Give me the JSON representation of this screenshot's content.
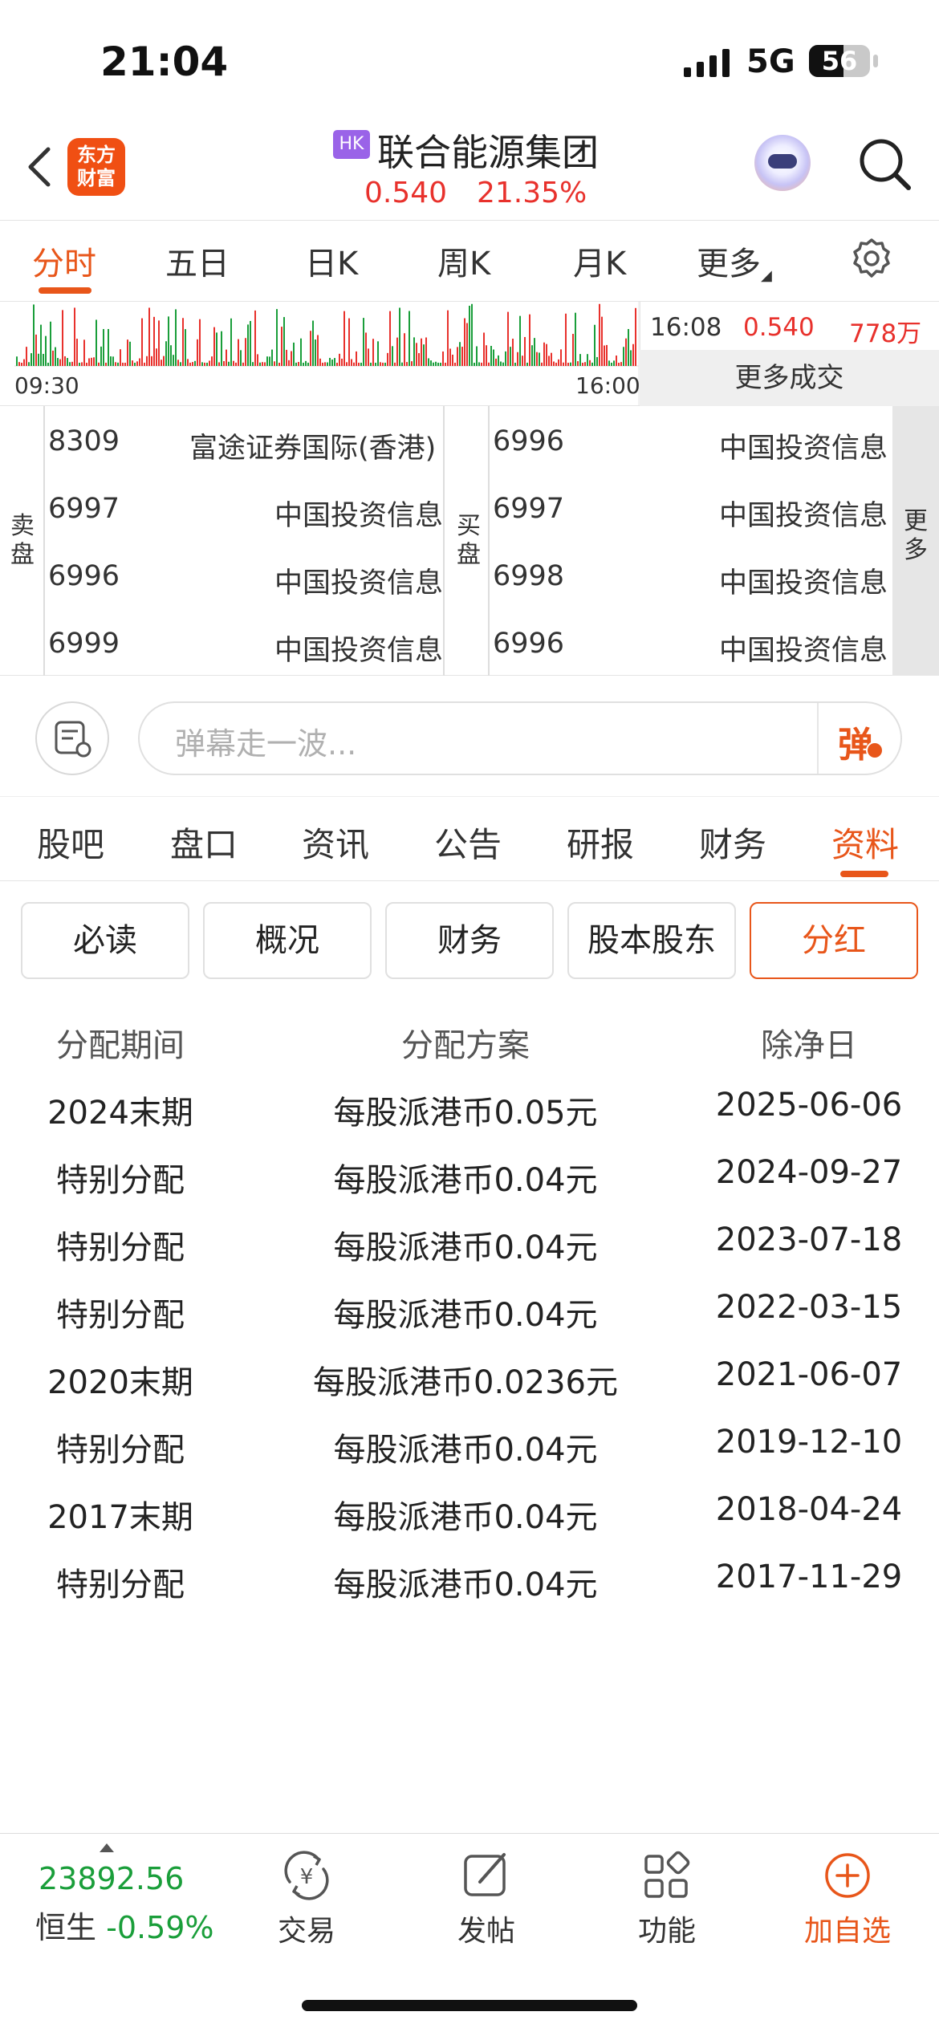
{
  "status_bar": {
    "time": "21:04",
    "network": "5G",
    "battery": "56",
    "battery_level": 0.56
  },
  "header": {
    "logo_text": [
      "东方",
      "财富"
    ],
    "market_badge": "HK",
    "stock_name": "联合能源集团",
    "price": "0.540",
    "change_pct": "21.35%",
    "icons": [
      "back-icon",
      "robot-avatar-icon",
      "search-icon"
    ],
    "colors": {
      "up": "#e8312c",
      "accent": "#e8561a",
      "badge": "#9a63e8"
    }
  },
  "chart_tabs": {
    "items": [
      "分时",
      "五日",
      "日K",
      "周K",
      "月K",
      "更多"
    ],
    "active": "分时",
    "settings_icon": "gear-icon"
  },
  "volume_strip": {
    "start_time": "09:30",
    "end_time": "16:00",
    "last_trade": {
      "time": "16:08",
      "price": "0.540",
      "volume": "778万"
    },
    "more_trades_label": "更多成交",
    "colors": {
      "up": "#e8312c",
      "down": "#1a9e3a"
    }
  },
  "broker_queue": {
    "sell_label": [
      "卖",
      "盘"
    ],
    "buy_label": [
      "买",
      "盘"
    ],
    "more_label": [
      "更",
      "多"
    ],
    "sell": [
      {
        "code": "8309",
        "name": "富途证券国际(香港)"
      },
      {
        "code": "6997",
        "name": "中国投资信息"
      },
      {
        "code": "6996",
        "name": "中国投资信息"
      },
      {
        "code": "6999",
        "name": "中国投资信息"
      }
    ],
    "buy": [
      {
        "code": "6996",
        "name": "中国投资信息"
      },
      {
        "code": "6997",
        "name": "中国投资信息"
      },
      {
        "code": "6998",
        "name": "中国投资信息"
      },
      {
        "code": "6996",
        "name": "中国投资信息"
      }
    ]
  },
  "comment_bar": {
    "placeholder": "弹幕走一波...",
    "danmaku_button": "弹"
  },
  "info_tabs": {
    "items": [
      "股吧",
      "盘口",
      "资讯",
      "公告",
      "研报",
      "财务",
      "资料"
    ],
    "active": "资料"
  },
  "profile_subtabs": {
    "items": [
      "必读",
      "概况",
      "财务",
      "股本股东",
      "分红"
    ],
    "active": "分红"
  },
  "dividends": {
    "headers": [
      "分配期间",
      "分配方案",
      "除净日"
    ],
    "rows": [
      [
        "2024末期",
        "每股派港币0.05元",
        "2025-06-06"
      ],
      [
        "特别分配",
        "每股派港币0.04元",
        "2024-09-27"
      ],
      [
        "特别分配",
        "每股派港币0.04元",
        "2023-07-18"
      ],
      [
        "特别分配",
        "每股派港币0.04元",
        "2022-03-15"
      ],
      [
        "2020末期",
        "每股派港币0.0236元",
        "2021-06-07"
      ],
      [
        "特别分配",
        "每股派港币0.04元",
        "2019-12-10"
      ],
      [
        "2017末期",
        "每股派港币0.04元",
        "2018-04-24"
      ],
      [
        "特别分配",
        "每股派港币0.04元",
        "2017-11-29"
      ]
    ]
  },
  "bottom_bar": {
    "index_value": "23892.56",
    "index_name": "恒生",
    "index_change": "-0.59%",
    "items": [
      {
        "label": "交易",
        "icon": "yen-exchange-icon"
      },
      {
        "label": "发帖",
        "icon": "edit-post-icon"
      },
      {
        "label": "功能",
        "icon": "grid-apps-icon"
      },
      {
        "label": "加自选",
        "icon": "plus-circle-icon"
      }
    ]
  }
}
